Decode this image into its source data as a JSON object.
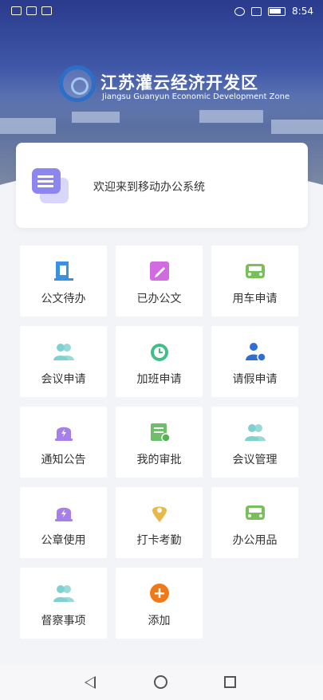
{
  "status": {
    "time": "8:54"
  },
  "brand": {
    "name_cn": "江苏灌云经济开发区",
    "name_en": "Jiangsu Guanyun Economic Development Zone"
  },
  "welcome": {
    "text": "欢迎来到移动办公系统"
  },
  "tiles": [
    {
      "label": "公文待办",
      "icon": "document-pending-icon",
      "color": "#3d8fe0"
    },
    {
      "label": "已办公文",
      "icon": "edit-document-icon",
      "color": "#d16be0"
    },
    {
      "label": "用车申请",
      "icon": "car-icon",
      "color": "#79c05a"
    },
    {
      "label": "会议申请",
      "icon": "people-icon",
      "color": "#7fd1cf"
    },
    {
      "label": "加班申请",
      "icon": "alarm-clock-icon",
      "color": "#3fbf88"
    },
    {
      "label": "请假申请",
      "icon": "person-clock-icon",
      "color": "#2f6fd1"
    },
    {
      "label": "通知公告",
      "icon": "bell-icon",
      "color": "#a77fe8"
    },
    {
      "label": "我的审批",
      "icon": "approval-icon",
      "color": "#6fbf6a"
    },
    {
      "label": "会议管理",
      "icon": "people-icon",
      "color": "#7fd1cf"
    },
    {
      "label": "公章使用",
      "icon": "bell-icon",
      "color": "#a77fe8"
    },
    {
      "label": "打卡考勤",
      "icon": "location-pin-icon",
      "color": "#e7b84a"
    },
    {
      "label": "办公用品",
      "icon": "car-icon",
      "color": "#79c05a"
    },
    {
      "label": "督察事项",
      "icon": "people-icon",
      "color": "#7fd1cf"
    },
    {
      "label": "添加",
      "icon": "add-icon",
      "color": "#f07a1a"
    }
  ]
}
